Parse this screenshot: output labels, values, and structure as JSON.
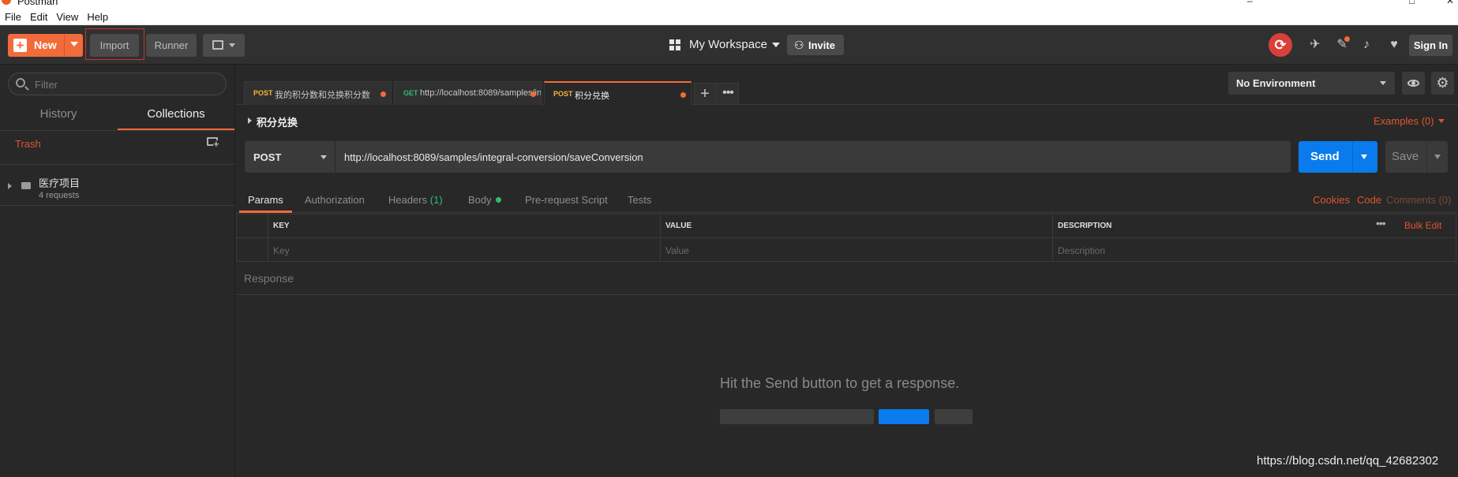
{
  "window": {
    "title": "Postman",
    "controls": [
      "–",
      "□",
      "✕"
    ]
  },
  "menu": [
    "File",
    "Edit",
    "View",
    "Help"
  ],
  "header": {
    "new_label": "New",
    "import_label": "Import",
    "runner_label": "Runner",
    "workspace_label": "My Workspace",
    "invite_label": "Invite",
    "signin_label": "Sign In",
    "invite_icon": "👤+"
  },
  "sidebar": {
    "filter_placeholder": "Filter",
    "tab_history": "History",
    "tab_collections": "Collections",
    "trash_label": "Trash",
    "collections": [
      {
        "name": "医疗项目",
        "count": "4 requests"
      }
    ]
  },
  "request_tabs": [
    {
      "method": "POST",
      "title": "我的积分数和兑换积分数",
      "unsaved": true,
      "active": false
    },
    {
      "method": "GET",
      "title": "http://localhost:8089/samples/in",
      "unsaved": true,
      "active": false
    },
    {
      "method": "POST",
      "title": "积分兑换",
      "unsaved": true,
      "active": true
    }
  ],
  "environment": {
    "selected": "No Environment"
  },
  "request": {
    "name": "积分兑换",
    "examples_label": "Examples (0)",
    "method": "POST",
    "url": "http://localhost:8089/samples/integral-conversion/saveConversion",
    "send_label": "Send",
    "save_label": "Save"
  },
  "subtabs": {
    "params": "Params",
    "authorization": "Authorization",
    "headers": "Headers",
    "headers_count": "(1)",
    "body": "Body",
    "prerequest": "Pre-request Script",
    "tests": "Tests",
    "cookies": "Cookies",
    "code": "Code",
    "comments": "Comments (0)"
  },
  "params_table": {
    "headers": [
      "KEY",
      "VALUE",
      "DESCRIPTION"
    ],
    "placeholders": [
      "Key",
      "Value",
      "Description"
    ],
    "bulk_edit": "Bulk Edit"
  },
  "response": {
    "label": "Response",
    "empty_message": "Hit the Send button to get a response."
  },
  "watermark": "https://blog.csdn.net/qq_42682302",
  "colors": {
    "accent_orange": "#f26b3a",
    "send_blue": "#097bed",
    "post_method": "#f5b43a",
    "get_method": "#2ebd74",
    "sync_red": "#d9403a"
  }
}
